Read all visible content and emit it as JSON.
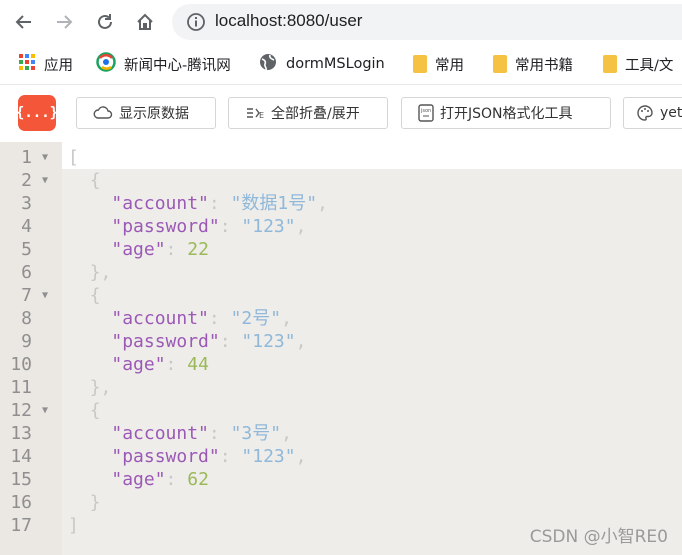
{
  "browser": {
    "url": "localhost:8080/user",
    "bookmarks": [
      "应用",
      "新闻中心-腾讯网",
      "dormMSLogin",
      "常用",
      "常用书籍",
      "工具/文"
    ]
  },
  "toolbar": {
    "logo": "{...}",
    "buttons": [
      "显示原数据",
      "全部折叠/展开",
      "打开JSON格式化工具",
      "yeti"
    ]
  },
  "code": {
    "lines": [
      {
        "n": "1",
        "fold": true,
        "indent": "",
        "tokens": [
          [
            "punc",
            "["
          ]
        ]
      },
      {
        "n": "2",
        "fold": true,
        "indent": "  ",
        "tokens": [
          [
            "punc",
            "{"
          ]
        ]
      },
      {
        "n": "3",
        "fold": false,
        "indent": "    ",
        "tokens": [
          [
            "key",
            "\"account\""
          ],
          [
            "punc",
            ": "
          ],
          [
            "str",
            "\"数据1号\""
          ],
          [
            "punc",
            ","
          ]
        ]
      },
      {
        "n": "4",
        "fold": false,
        "indent": "    ",
        "tokens": [
          [
            "key",
            "\"password\""
          ],
          [
            "punc",
            ": "
          ],
          [
            "str",
            "\"123\""
          ],
          [
            "punc",
            ","
          ]
        ]
      },
      {
        "n": "5",
        "fold": false,
        "indent": "    ",
        "tokens": [
          [
            "key",
            "\"age\""
          ],
          [
            "punc",
            ": "
          ],
          [
            "num",
            "22"
          ]
        ]
      },
      {
        "n": "6",
        "fold": false,
        "indent": "  ",
        "tokens": [
          [
            "punc",
            "},"
          ]
        ]
      },
      {
        "n": "7",
        "fold": true,
        "indent": "  ",
        "tokens": [
          [
            "punc",
            "{"
          ]
        ]
      },
      {
        "n": "8",
        "fold": false,
        "indent": "    ",
        "tokens": [
          [
            "key",
            "\"account\""
          ],
          [
            "punc",
            ": "
          ],
          [
            "str",
            "\"2号\""
          ],
          [
            "punc",
            ","
          ]
        ]
      },
      {
        "n": "9",
        "fold": false,
        "indent": "    ",
        "tokens": [
          [
            "key",
            "\"password\""
          ],
          [
            "punc",
            ": "
          ],
          [
            "str",
            "\"123\""
          ],
          [
            "punc",
            ","
          ]
        ]
      },
      {
        "n": "10",
        "fold": false,
        "indent": "    ",
        "tokens": [
          [
            "key",
            "\"age\""
          ],
          [
            "punc",
            ": "
          ],
          [
            "num",
            "44"
          ]
        ]
      },
      {
        "n": "11",
        "fold": false,
        "indent": "  ",
        "tokens": [
          [
            "punc",
            "},"
          ]
        ]
      },
      {
        "n": "12",
        "fold": true,
        "indent": "  ",
        "tokens": [
          [
            "punc",
            "{"
          ]
        ]
      },
      {
        "n": "13",
        "fold": false,
        "indent": "    ",
        "tokens": [
          [
            "key",
            "\"account\""
          ],
          [
            "punc",
            ": "
          ],
          [
            "str",
            "\"3号\""
          ],
          [
            "punc",
            ","
          ]
        ]
      },
      {
        "n": "14",
        "fold": false,
        "indent": "    ",
        "tokens": [
          [
            "key",
            "\"password\""
          ],
          [
            "punc",
            ": "
          ],
          [
            "str",
            "\"123\""
          ],
          [
            "punc",
            ","
          ]
        ]
      },
      {
        "n": "15",
        "fold": false,
        "indent": "    ",
        "tokens": [
          [
            "key",
            "\"age\""
          ],
          [
            "punc",
            ": "
          ],
          [
            "num",
            "62"
          ]
        ]
      },
      {
        "n": "16",
        "fold": false,
        "indent": "  ",
        "tokens": [
          [
            "punc",
            "}"
          ]
        ]
      },
      {
        "n": "17",
        "fold": false,
        "indent": "",
        "tokens": [
          [
            "punc",
            "]"
          ]
        ]
      }
    ]
  },
  "watermark": "CSDN @小智RE0"
}
